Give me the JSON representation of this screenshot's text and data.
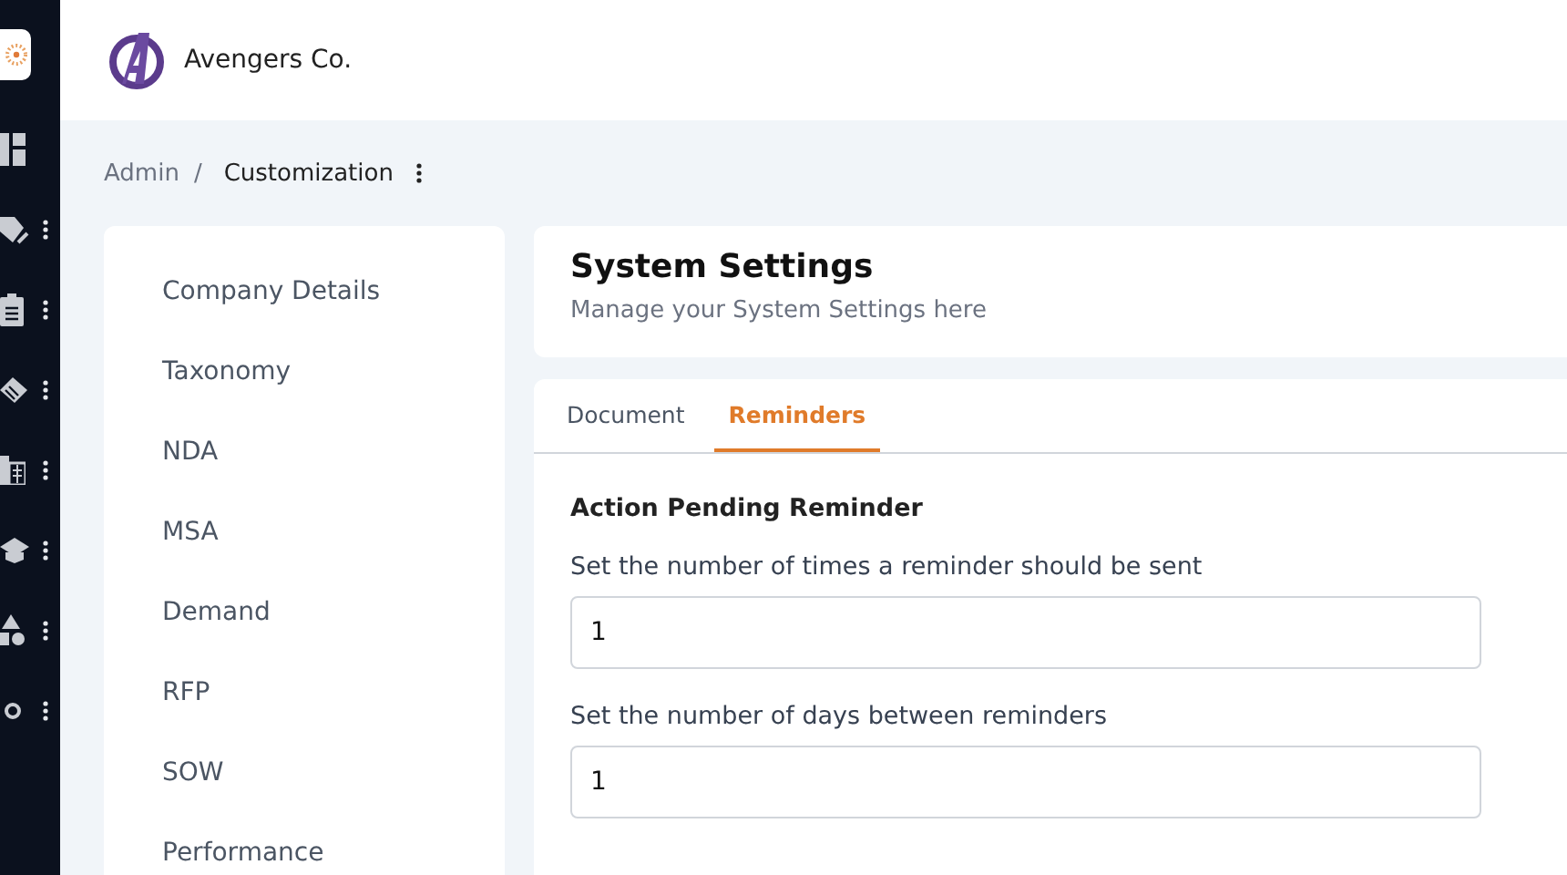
{
  "brand": {
    "name": "Avengers Co."
  },
  "sidebar": {
    "items": [
      {
        "kind": "grid",
        "menu": false
      },
      {
        "kind": "tag",
        "menu": true
      },
      {
        "kind": "clipboard",
        "menu": true
      },
      {
        "kind": "handshake",
        "menu": true
      },
      {
        "kind": "building",
        "menu": true
      },
      {
        "kind": "cap",
        "menu": true
      },
      {
        "kind": "shapes",
        "menu": true
      },
      {
        "kind": "person",
        "menu": true
      }
    ]
  },
  "breadcrumb": [
    {
      "label": "Admin",
      "current": false,
      "separator": "/"
    },
    {
      "label": "Customization",
      "current": true
    }
  ],
  "settings_menu": [
    "Company Details",
    "Taxonomy",
    "NDA",
    "MSA",
    "Demand",
    "RFP",
    "SOW",
    "Performance"
  ],
  "header_card": {
    "title": "System Settings",
    "subtitle": "Manage your System Settings here"
  },
  "tabs": [
    {
      "label": "Document",
      "selected": false
    },
    {
      "label": "Reminders",
      "selected": true
    }
  ],
  "section": {
    "title": "Action Pending Reminder",
    "fields": [
      {
        "label": "Set the number of times a reminder should be sent",
        "value": "1"
      },
      {
        "label": "Set the number of days between reminders",
        "value": "1"
      }
    ]
  }
}
